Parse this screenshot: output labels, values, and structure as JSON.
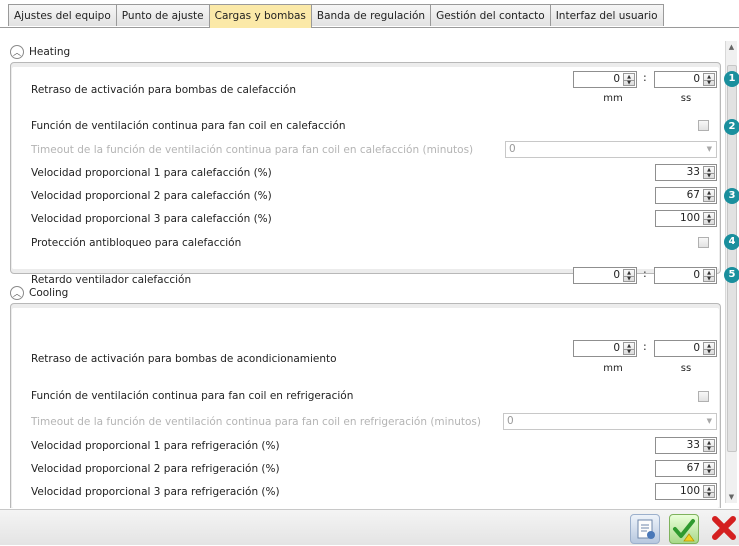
{
  "tabs": [
    {
      "label": "Ajustes del equipo",
      "active": false
    },
    {
      "label": "Punto de ajuste",
      "active": false
    },
    {
      "label": "Cargas y bombas",
      "active": true
    },
    {
      "label": "Banda de regulación",
      "active": false
    },
    {
      "label": "Gestión del contacto",
      "active": false
    },
    {
      "label": "Interfaz del usuario",
      "active": false
    }
  ],
  "heating": {
    "title": "Heating",
    "activation_delay": {
      "label": "Retraso de activación para bombas de calefacción",
      "mm": "0",
      "ss": "0",
      "mm_unit": "mm",
      "ss_unit": "ss"
    },
    "continuous_fan": {
      "label": "Función de ventilación continua para fan coil en calefacción",
      "checked": false
    },
    "timeout": {
      "label": "Timeout de la función de ventilación continua para fan coil en calefacción (minutos)",
      "value": "0",
      "disabled": true
    },
    "speed1": {
      "label": "Velocidad proporcional 1 para calefacción (%)",
      "value": "33"
    },
    "speed2": {
      "label": "Velocidad proporcional 2 para calefacción (%)",
      "value": "67"
    },
    "speed3": {
      "label": "Velocidad proporcional 3 para calefacción (%)",
      "value": "100"
    },
    "antiblock": {
      "label": "Protección antibloqueo para calefacción",
      "checked": false
    },
    "fan_delay": {
      "label": "Retardo ventilador calefacción",
      "mm": "0",
      "ss": "0"
    }
  },
  "cooling": {
    "title": "Cooling",
    "activation_delay": {
      "label": "Retraso de activación para bombas de acondicionamiento",
      "mm": "0",
      "ss": "0",
      "mm_unit": "mm",
      "ss_unit": "ss"
    },
    "continuous_fan": {
      "label": "Función de ventilación continua para fan coil en refrigeración",
      "checked": false
    },
    "timeout": {
      "label": "Timeout de la función de ventilación continua para fan coil en refrigeración (minutos)",
      "value": "0",
      "disabled": true
    },
    "speed1": {
      "label": "Velocidad proporcional 1 para refrigeración (%)",
      "value": "33"
    },
    "speed2": {
      "label": "Velocidad proporcional 2 para refrigeración (%)",
      "value": "67"
    },
    "speed3": {
      "label": "Velocidad proporcional 3 para refrigeración (%)",
      "value": "100"
    }
  },
  "callouts": [
    "1",
    "2",
    "3",
    "4",
    "5"
  ],
  "colon": ":",
  "icons": {
    "collapse": "chevron-up-icon",
    "report": "report-icon",
    "confirm": "check-icon",
    "cancel": "close-icon"
  },
  "colors": {
    "active_tab": "#fbe9a8",
    "callout": "#1a8f9d",
    "confirm": "#3aa53a",
    "cancel": "#d42020"
  }
}
